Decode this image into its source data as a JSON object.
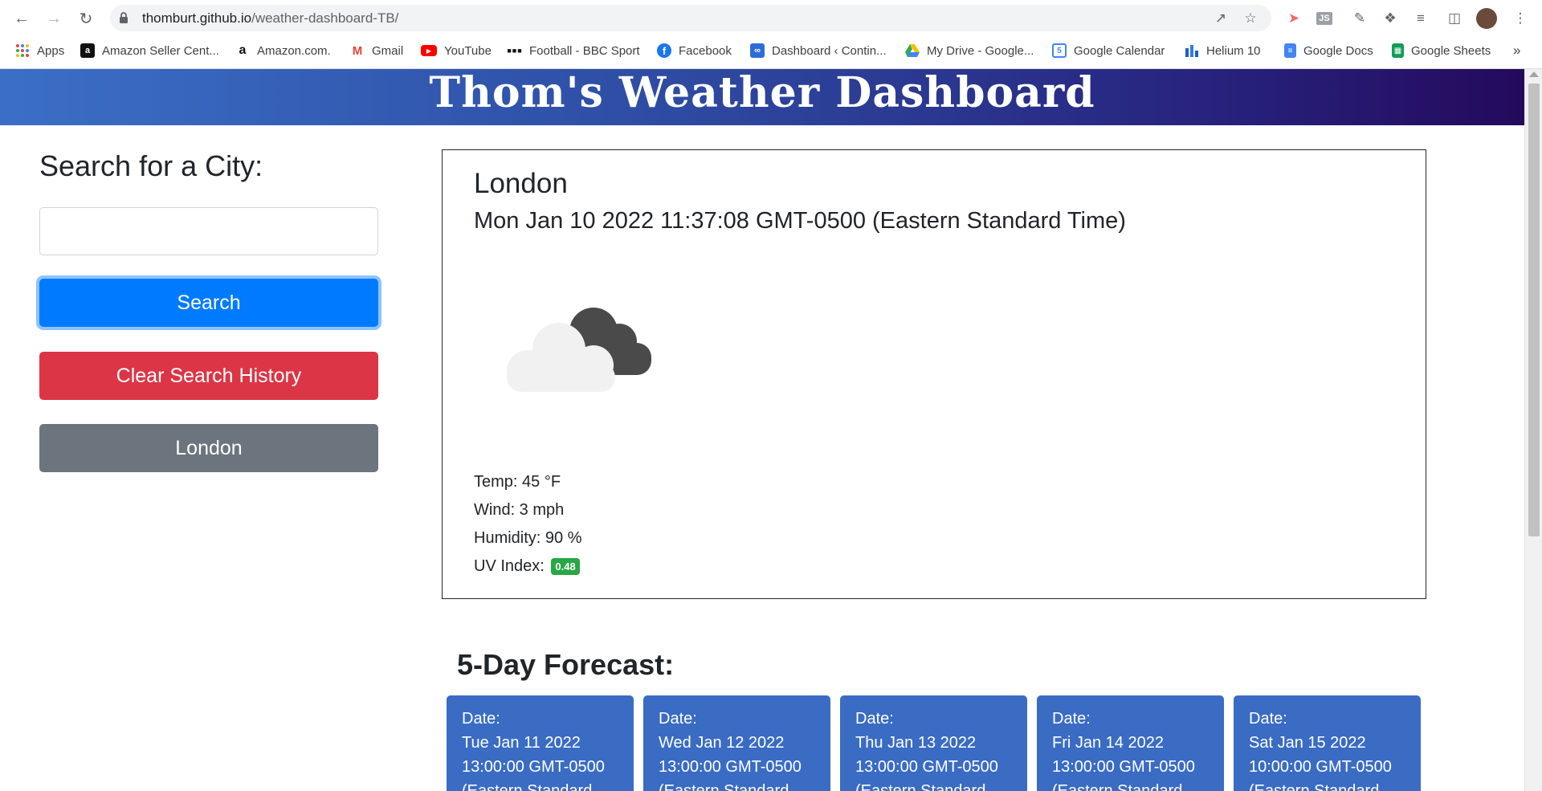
{
  "browser": {
    "url_host": "thomburt.github.io",
    "url_path": "/weather-dashboard-TB/",
    "bookmarks": [
      {
        "label": "Apps",
        "icon": "apps-grid-icon"
      },
      {
        "label": "Amazon Seller Cent...",
        "icon": "amazon-icon"
      },
      {
        "label": "Amazon.com.",
        "icon": "amazon-icon"
      },
      {
        "label": "Gmail",
        "icon": "gmail-icon"
      },
      {
        "label": "YouTube",
        "icon": "youtube-icon"
      },
      {
        "label": "Football - BBC Sport",
        "icon": "bbc-icon"
      },
      {
        "label": "Facebook",
        "icon": "facebook-icon"
      },
      {
        "label": "Dashboard ‹ Contin...",
        "icon": "dashboard-icon"
      },
      {
        "label": "My Drive - Google...",
        "icon": "google-drive-icon"
      },
      {
        "label": "Google Calendar",
        "icon": "google-calendar-icon"
      },
      {
        "label": "Helium 10",
        "icon": "helium10-icon"
      },
      {
        "label": "Google Docs",
        "icon": "google-docs-icon"
      },
      {
        "label": "Google Sheets",
        "icon": "google-sheets-icon"
      }
    ],
    "more_bookmarks": "»"
  },
  "header": {
    "title": "Thom's Weather Dashboard"
  },
  "sidebar": {
    "title": "Search for a City:",
    "search_value": "",
    "search_button": "Search",
    "clear_button": "Clear Search History",
    "history": [
      "London"
    ]
  },
  "current": {
    "city": "London",
    "datetime": "Mon Jan 10 2022 11:37:08 GMT-0500 (Eastern Standard Time)",
    "icon": "cloudy-icon",
    "temp": "Temp: 45 °F",
    "wind": "Wind: 3 mph",
    "humidity": "Humidity: 90 %",
    "uv_label": "UV Index:",
    "uv_value": "0.48"
  },
  "forecast": {
    "title": "5-Day Forecast:",
    "cards": [
      {
        "label": "Date:",
        "date": "Tue Jan 11 2022",
        "time": "13:00:00 GMT-0500",
        "tz": "(Eastern Standard"
      },
      {
        "label": "Date:",
        "date": "Wed Jan 12 2022",
        "time": "13:00:00 GMT-0500",
        "tz": "(Eastern Standard"
      },
      {
        "label": "Date:",
        "date": "Thu Jan 13 2022",
        "time": "13:00:00 GMT-0500",
        "tz": "(Eastern Standard"
      },
      {
        "label": "Date:",
        "date": "Fri Jan 14 2022",
        "time": "13:00:00 GMT-0500",
        "tz": "(Eastern Standard"
      },
      {
        "label": "Date:",
        "date": "Sat Jan 15 2022",
        "time": "10:00:00 GMT-0500",
        "tz": "(Eastern Standard"
      }
    ]
  },
  "colors": {
    "search": "#007bff",
    "clear": "#dc3545",
    "history": "#6c757d",
    "forecast_card": "#3a6cc4",
    "uv_badge": "#28a745"
  }
}
